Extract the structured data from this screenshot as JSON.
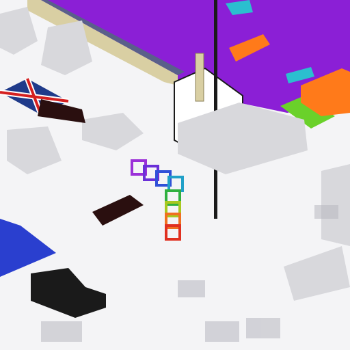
{
  "scene": {
    "kind": "isometric-voxel-world",
    "colors": {
      "ground": "#f4f4f6",
      "shadow": "#b8b8c0",
      "purple_water": "#8b1fd6",
      "wall_stone": "#5a5f8a",
      "wall_top": "#d9cfa3",
      "flag_blue": "#1f3a8a",
      "flag_red": "#d42020",
      "orange_machinery": "#ff7a1a",
      "cyan_machinery": "#2bbfcf",
      "green_patch": "#6ad12a",
      "blue_pool": "#2a3fcf",
      "black_tower": "#1a1a1a"
    },
    "rainbow_cubes": [
      "#9b30d8",
      "#6a30d8",
      "#3050d8",
      "#20a0c8",
      "#30b040",
      "#a8c820",
      "#f0a020",
      "#f07020",
      "#e03020"
    ],
    "objects": [
      "purple-water-area",
      "castle-wall",
      "union-jack-flag",
      "rainbow-cube-stack",
      "white-tower-building",
      "tall-black-pole",
      "orange-machinery",
      "green-patch",
      "blue-pool",
      "voxel-crowds"
    ]
  }
}
